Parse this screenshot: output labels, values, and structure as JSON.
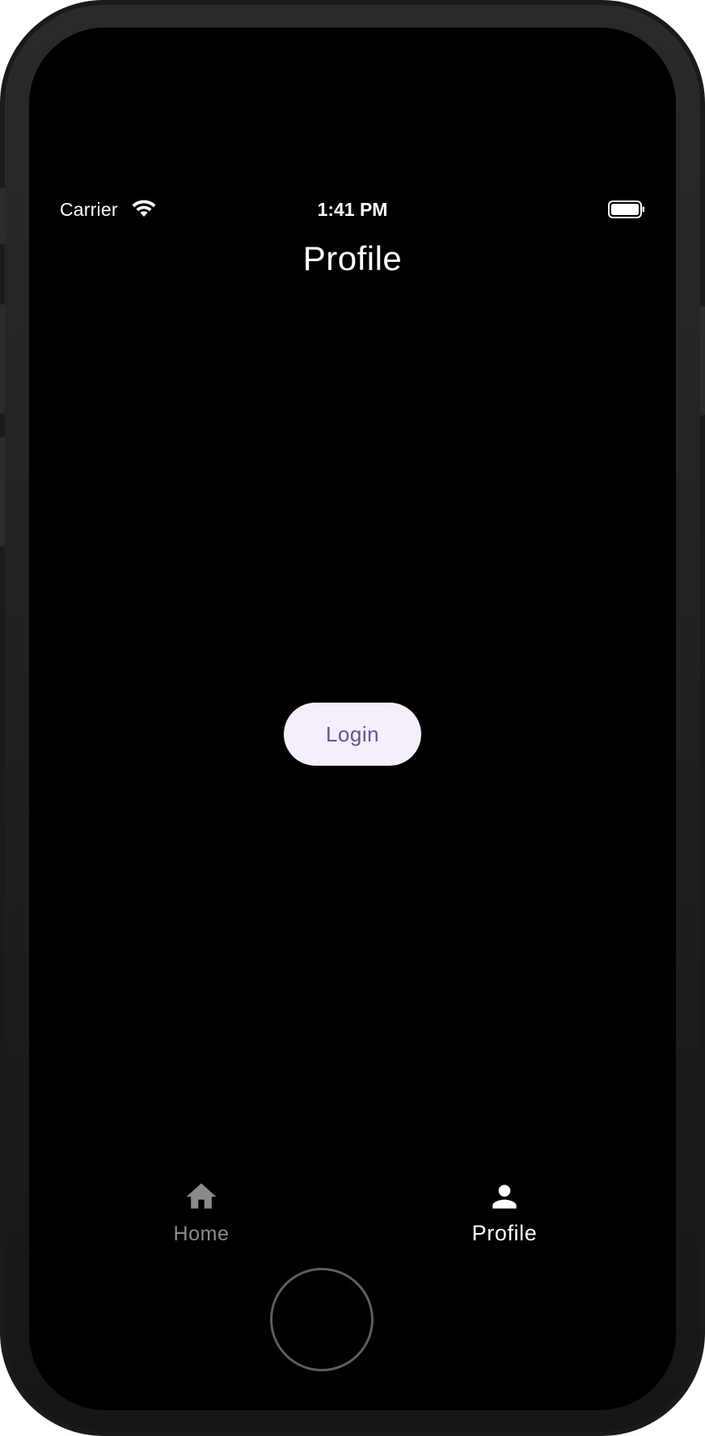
{
  "status_bar": {
    "carrier": "Carrier",
    "time": "1:41 PM",
    "wifi_icon": "wifi-icon",
    "battery_icon": "battery-full-icon"
  },
  "page": {
    "title": "Profile"
  },
  "main": {
    "login_label": "Login"
  },
  "tab_bar": {
    "items": [
      {
        "label": "Home",
        "icon": "home-icon",
        "selected": false
      },
      {
        "label": "Profile",
        "icon": "person-icon",
        "selected": true
      }
    ]
  },
  "colors": {
    "background": "#000000",
    "button_bg": "#f4effa",
    "button_text": "#65558f",
    "tab_inactive": "#8a8a8a",
    "tab_active": "#ffffff"
  }
}
